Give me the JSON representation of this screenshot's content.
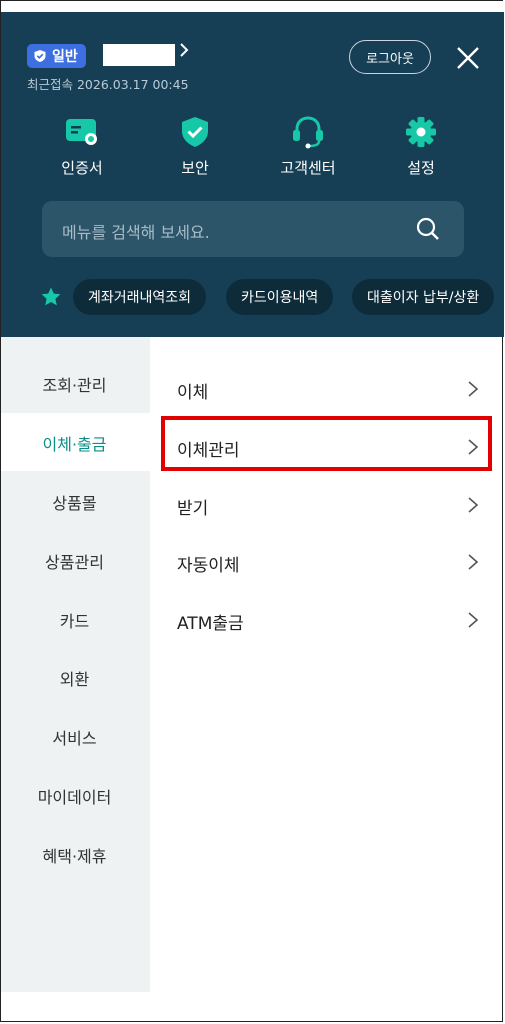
{
  "account": {
    "grade_badge": "일반",
    "last_login": "최근접속 2026.03.17 00:45",
    "logout_label": "로그아웃"
  },
  "quick_menu": [
    {
      "label": "인증서",
      "icon": "certificate-icon"
    },
    {
      "label": "보안",
      "icon": "shield-icon"
    },
    {
      "label": "고객센터",
      "icon": "headset-icon"
    },
    {
      "label": "설정",
      "icon": "gear-icon"
    }
  ],
  "search": {
    "placeholder": "메뉴를 검색해 보세요."
  },
  "favorites": {
    "icon": "star-icon",
    "chips": [
      "계좌거래내역조회",
      "카드이용내역",
      "대출이자 납부/상환"
    ]
  },
  "sidebar": {
    "items": [
      {
        "label": "조회·관리"
      },
      {
        "label": "이체·출금",
        "active": true
      },
      {
        "label": "상품몰"
      },
      {
        "label": "상품관리"
      },
      {
        "label": "카드"
      },
      {
        "label": "외환"
      },
      {
        "label": "서비스"
      },
      {
        "label": "마이데이터"
      },
      {
        "label": "혜택·제휴"
      }
    ]
  },
  "submenu": {
    "items": [
      {
        "label": "이체"
      },
      {
        "label": "이체관리",
        "highlighted": true
      },
      {
        "label": "받기"
      },
      {
        "label": "자동이체"
      },
      {
        "label": "ATM출금"
      }
    ]
  },
  "colors": {
    "header_bg": "#163f55",
    "accent": "#0a8f86",
    "highlight_border": "#e20000",
    "badge_bg": "#3d6fe0"
  }
}
